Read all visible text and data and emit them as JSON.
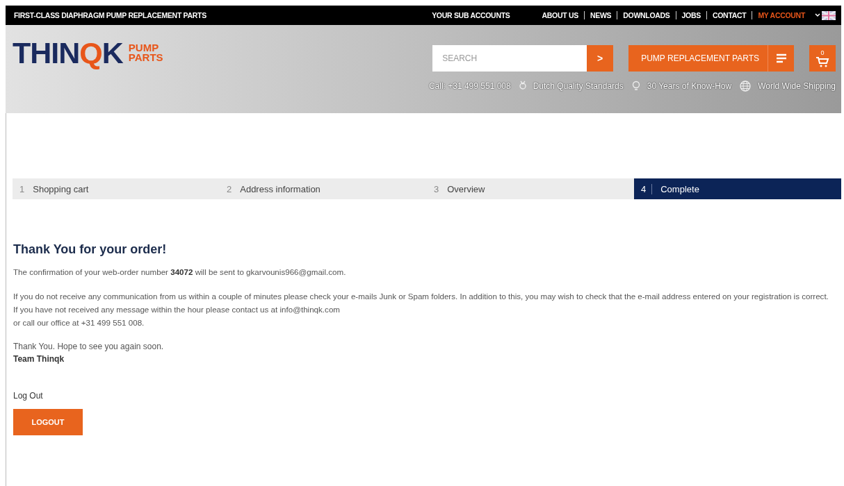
{
  "top_bar": {
    "tagline": "FIRST-CLASS DIAPHRAGM PUMP REPLACEMENT PARTS",
    "links": [
      {
        "label": "YOUR SUB ACCOUNTS",
        "selected": false,
        "separated": false
      },
      {
        "label": "ABOUT US",
        "selected": false,
        "separated": true
      },
      {
        "label": "NEWS",
        "selected": false,
        "separated": true
      },
      {
        "label": "DOWNLOADS",
        "selected": false,
        "separated": true
      },
      {
        "label": "JOBS",
        "selected": false,
        "separated": true
      },
      {
        "label": "CONTACT",
        "selected": false,
        "separated": true
      },
      {
        "label": "MY ACCOUNT",
        "selected": true,
        "separated": false
      }
    ]
  },
  "header": {
    "logo": {
      "before": "THIN",
      "highlight": "Q",
      "after": "K",
      "sub_top": "PUMP",
      "sub_bottom": "PARTS"
    },
    "search": {
      "placeholder": "SEARCH",
      "button": ">"
    },
    "menu_button": "PUMP REPLACEMENT PARTS",
    "cart_count": "0",
    "usps": [
      {
        "kind": "phone",
        "text": "Call: +31 499 551 008"
      },
      {
        "kind": "medal",
        "text": "Dutch Quality Standards"
      },
      {
        "kind": "bulb",
        "text": "30 Years of Know-How"
      },
      {
        "kind": "globe",
        "text": "World Wide Shipping"
      }
    ]
  },
  "steps": [
    {
      "number": "1",
      "label": "Shopping cart",
      "selected": false
    },
    {
      "number": "2",
      "label": "Address information",
      "selected": false
    },
    {
      "number": "3",
      "label": "Overview",
      "selected": false
    },
    {
      "number": "4",
      "label": "Complete",
      "selected": true
    }
  ],
  "content": {
    "heading": "Thank You for your order!",
    "paragraphs": [
      "The confirmation of your web-order number **34072** will be sent to gkarvounis966@gmail.com.",
      "If you do not receive any communication from us within a couple of minutes please check your e-mails Junk or Spam folders. In addition to this, you may wish to check that the e-mail address entered on your registration is correct. If you have not received any message within the hour please contact us at info@thinqk.com\nor call our office at +31 499 551 008."
    ],
    "closing": "Thank You. Hope to see you again soon.",
    "signature": "Team Thinqk"
  },
  "logout": {
    "label": "Log Out",
    "button": "LOGOUT"
  }
}
